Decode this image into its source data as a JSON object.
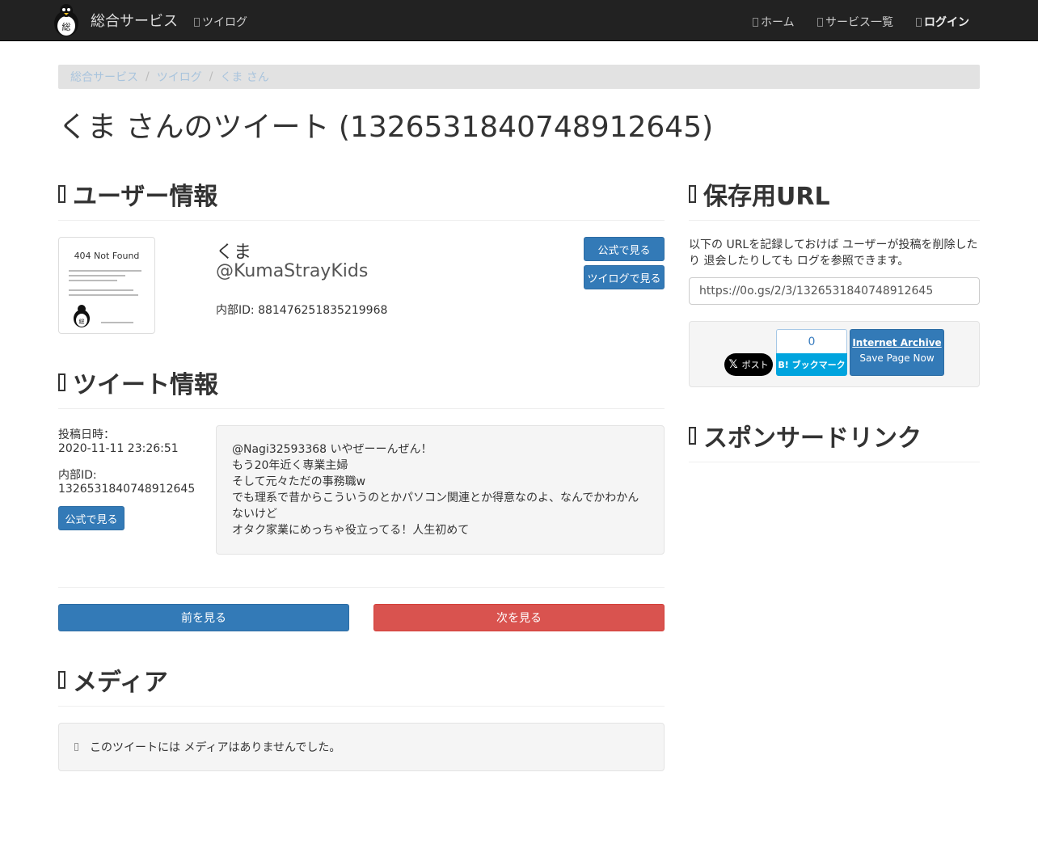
{
  "navbar": {
    "brand_logo_glyph": "総",
    "brand_text": "総合サービス",
    "twilog_link": "ツイログ",
    "home_link": "ホーム",
    "services_link": "サービス一覧",
    "login_link": "ログイン"
  },
  "breadcrumb": [
    "総合サービス",
    "ツイログ",
    "くま さん"
  ],
  "page_title": "くま さんのツイート (1326531840748912645)",
  "user_section": {
    "heading": "ユーザー情報",
    "avatar_title": "404 Not Found",
    "avatar_glyph": "総",
    "name": "くま",
    "handle": "@KumaStrayKids",
    "internal_id": "内部ID: 881476251835219968",
    "official_button": "公式で見る",
    "twilog_button": "ツイログで見る"
  },
  "tweet_section": {
    "heading": "ツイート情報",
    "posted_label": "投稿日時：",
    "posted_value": "2020-11-11 23:26:51",
    "id_label": "内部ID:",
    "id_value": "1326531840748912645",
    "official_button": "公式で見る",
    "text": "@Nagi32593368 いやぜーーんぜん！\nもう20年近く専業主婦\nそして元々ただの事務職w\nでも理系で昔からこういうのとかパソコン関連とか得意なのよ、なんでかわかんないけど\nオタク家業にめっちゃ役立ってる！人生初めて"
  },
  "pager": {
    "prev_button": "前を見る",
    "next_button": "次を見る"
  },
  "media_section": {
    "heading": "メディア",
    "empty_message": "このツイートには メディアはありませんでした。"
  },
  "save_section": {
    "heading": "保存用URL",
    "description": "以下の URLを記録しておけば ユーザーが投稿を削除したり 退会したりしても ログを参照できます。",
    "url": "https://0o.gs/2/3/1326531840748912645",
    "x_post_label": "ポスト",
    "x_glyph": "𝕏",
    "hatena_count": "0",
    "hatena_label": "B! ブックマーク",
    "ia_title": "Internet Archive",
    "ia_sub": "Save Page Now"
  },
  "sponsor_section": {
    "heading": "スポンサードリンク"
  },
  "colors": {
    "navbar_bg": "#222222",
    "primary": "#337ab7",
    "danger": "#d9534f",
    "hatena": "#00a4de",
    "breadcrumb_bg": "#e2e2e2"
  }
}
